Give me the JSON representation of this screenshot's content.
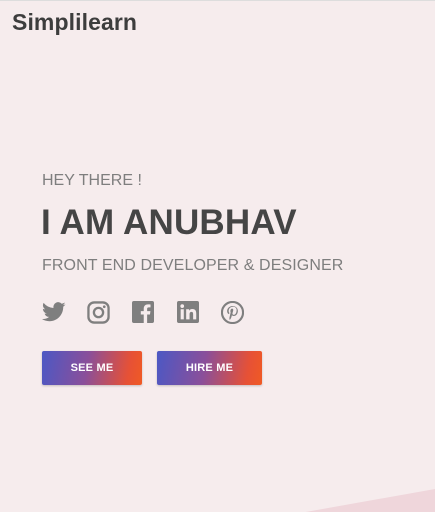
{
  "header": {
    "brand": "Simplilearn"
  },
  "hero": {
    "greeting": "HEY THERE !",
    "name": "I AM ANUBHAV",
    "role": "FRONT END DEVELOPER & DESIGNER"
  },
  "socials": {
    "items": [
      {
        "icon": "twitter-icon"
      },
      {
        "icon": "instagram-icon"
      },
      {
        "icon": "facebook-icon"
      },
      {
        "icon": "linkedin-icon"
      },
      {
        "icon": "pinterest-icon"
      }
    ],
    "color": "#7f7f7f"
  },
  "actions": {
    "see_me_label": "SEE ME",
    "hire_me_label": "HIRE ME"
  },
  "colors": {
    "background": "#f6eced",
    "accent_start": "#4c58c4",
    "accent_end": "#f05a24",
    "corner_shape": "#efd6db"
  }
}
